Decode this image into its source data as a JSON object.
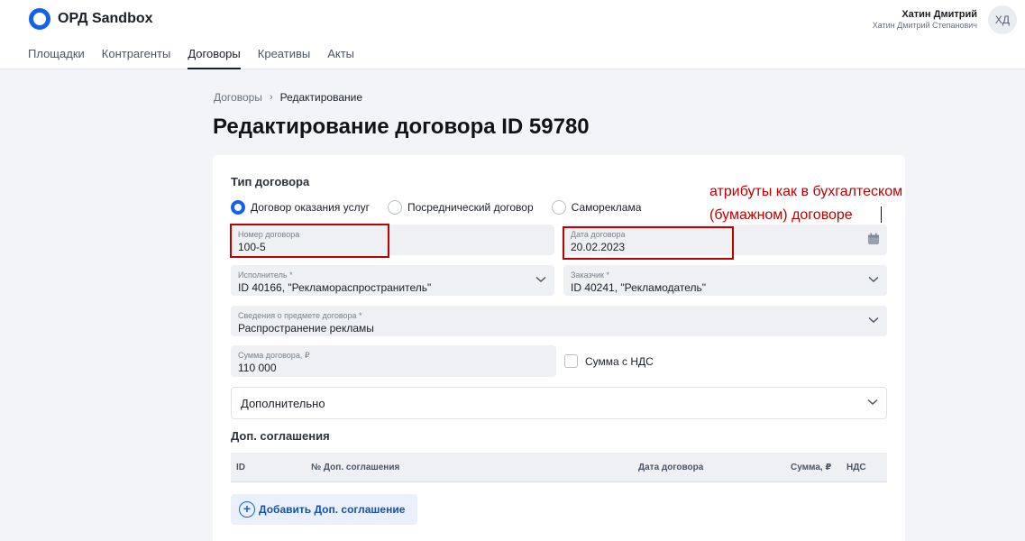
{
  "app": {
    "title": "ОРД Sandbox"
  },
  "nav": {
    "items": [
      {
        "label": "Площадки"
      },
      {
        "label": "Контрагенты"
      },
      {
        "label": "Договоры"
      },
      {
        "label": "Креативы"
      },
      {
        "label": "Акты"
      }
    ],
    "active": "Договоры"
  },
  "user": {
    "name": "Хатин Дмитрий",
    "full_name": "Хатин Дмитрий Степанович",
    "initials": "ХД"
  },
  "breadcrumb": {
    "parent": "Договоры",
    "separator": "›",
    "current": "Редактирование"
  },
  "page": {
    "title": "Редактирование договора ID 59780"
  },
  "form": {
    "type_label": "Тип договора",
    "contract_types": [
      {
        "label": "Договор оказания услуг",
        "checked": true
      },
      {
        "label": "Посреднический договор",
        "checked": false
      },
      {
        "label": "Самореклама",
        "checked": false
      }
    ],
    "number": {
      "label": "Номер договора",
      "value": "100-5"
    },
    "date": {
      "label": "Дата договора",
      "value": "20.02.2023",
      "icon": "calendar-icon"
    },
    "executor": {
      "label": "Исполнитель *",
      "value": "ID 40166, \"Рекламораспространитель\""
    },
    "customer": {
      "label": "Заказчик *",
      "value": "ID 40241, \"Рекламодатель\""
    },
    "subject": {
      "label": "Сведения о предмете договора *",
      "value": "Распространение рекламы"
    },
    "amount": {
      "label": "Сумма договора, ₽",
      "value": "110 000"
    },
    "vat_checkbox_label": "Сумма с НДС",
    "additional_label": "Дополнительно"
  },
  "supplements": {
    "title": "Доп. соглашения",
    "columns": [
      "ID",
      "№ Доп. соглашения",
      "Дата договора",
      "Сумма, ₽",
      "НДС"
    ],
    "add_button": "Добавить Доп. соглашение"
  },
  "annotation": {
    "line1": "атрибуты как в бухгалтеском",
    "line2": "(бумажном) договоре",
    "color": "#c00000"
  },
  "colors": {
    "accent": "#1562e8",
    "field_bg": "#eef0f3",
    "page_bg": "#f2f4f7"
  }
}
